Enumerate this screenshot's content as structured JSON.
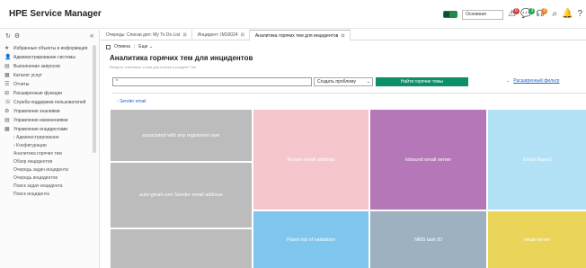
{
  "app_title": "HPE Service Manager",
  "header": {
    "select_value": "Основная",
    "badges": {
      "alerts": "6",
      "chats": "3",
      "tasks": "0"
    }
  },
  "sidebar": {
    "items": [
      {
        "icon": "star",
        "label": "Избранные объекты и информация"
      },
      {
        "icon": "person",
        "label": "Администрирование системы"
      },
      {
        "icon": "doc",
        "label": "Выполнение запросов"
      },
      {
        "icon": "grid",
        "label": "Каталог услуг"
      },
      {
        "icon": "list",
        "label": "Отчеты"
      },
      {
        "icon": "ext",
        "label": "Расширенные функции"
      },
      {
        "icon": "phone",
        "label": "Служба поддержки пользователей"
      },
      {
        "icon": "gear",
        "label": "Управление знаниями"
      },
      {
        "icon": "doc",
        "label": "Управление изменениями"
      },
      {
        "icon": "grid",
        "label": "Управление инцидентами"
      }
    ],
    "subitems": [
      "› Администрирование",
      "› Конфигурации",
      "Аналитика горячих тем",
      "Обзор инцидентов",
      "Очередь задач инцидента",
      "Очередь инцидентов",
      "Поиск задач инцидента",
      "Поиск инцидента"
    ]
  },
  "tabs": [
    {
      "label": "Очередь: Списки дел: My To Do List",
      "active": false
    },
    {
      "label": "Инцидент: IM10024",
      "active": false
    },
    {
      "label": "Аналитика горячих тем для инцидентов",
      "active": true
    }
  ],
  "toolbar": {
    "cancel": "Отмена",
    "more": "Еще"
  },
  "page": {
    "title": "Аналитика горячих тем для инцидентов",
    "subtitle": "Введите ключевые слова для поиска в разделе Тип",
    "search_value": "*",
    "select_value": "Создать проблему",
    "find_button": "Найти горячие темы",
    "advanced_filter": "Расширенный фильтр",
    "section": "Sender email"
  },
  "tiles": [
    {
      "label": "associated with any registered user",
      "color": "#bcbcbc"
    },
    {
      "label": "auto-gmail com Sender email address",
      "color": "#bcbcbc"
    },
    {
      "label": "",
      "color": "#bcbcbc"
    },
    {
      "label": "Known email address",
      "color": "#f5c7cd"
    },
    {
      "label": "Flavin list of validation",
      "color": "#7fc6ee"
    },
    {
      "label": "Inbound email server",
      "color": "#b677b9"
    },
    {
      "label": "NMS task ID",
      "color": "#9db1c0"
    },
    {
      "label": "Email Based",
      "color": "#b3e2f6"
    },
    {
      "label": "email server",
      "color": "#ead55a"
    }
  ]
}
